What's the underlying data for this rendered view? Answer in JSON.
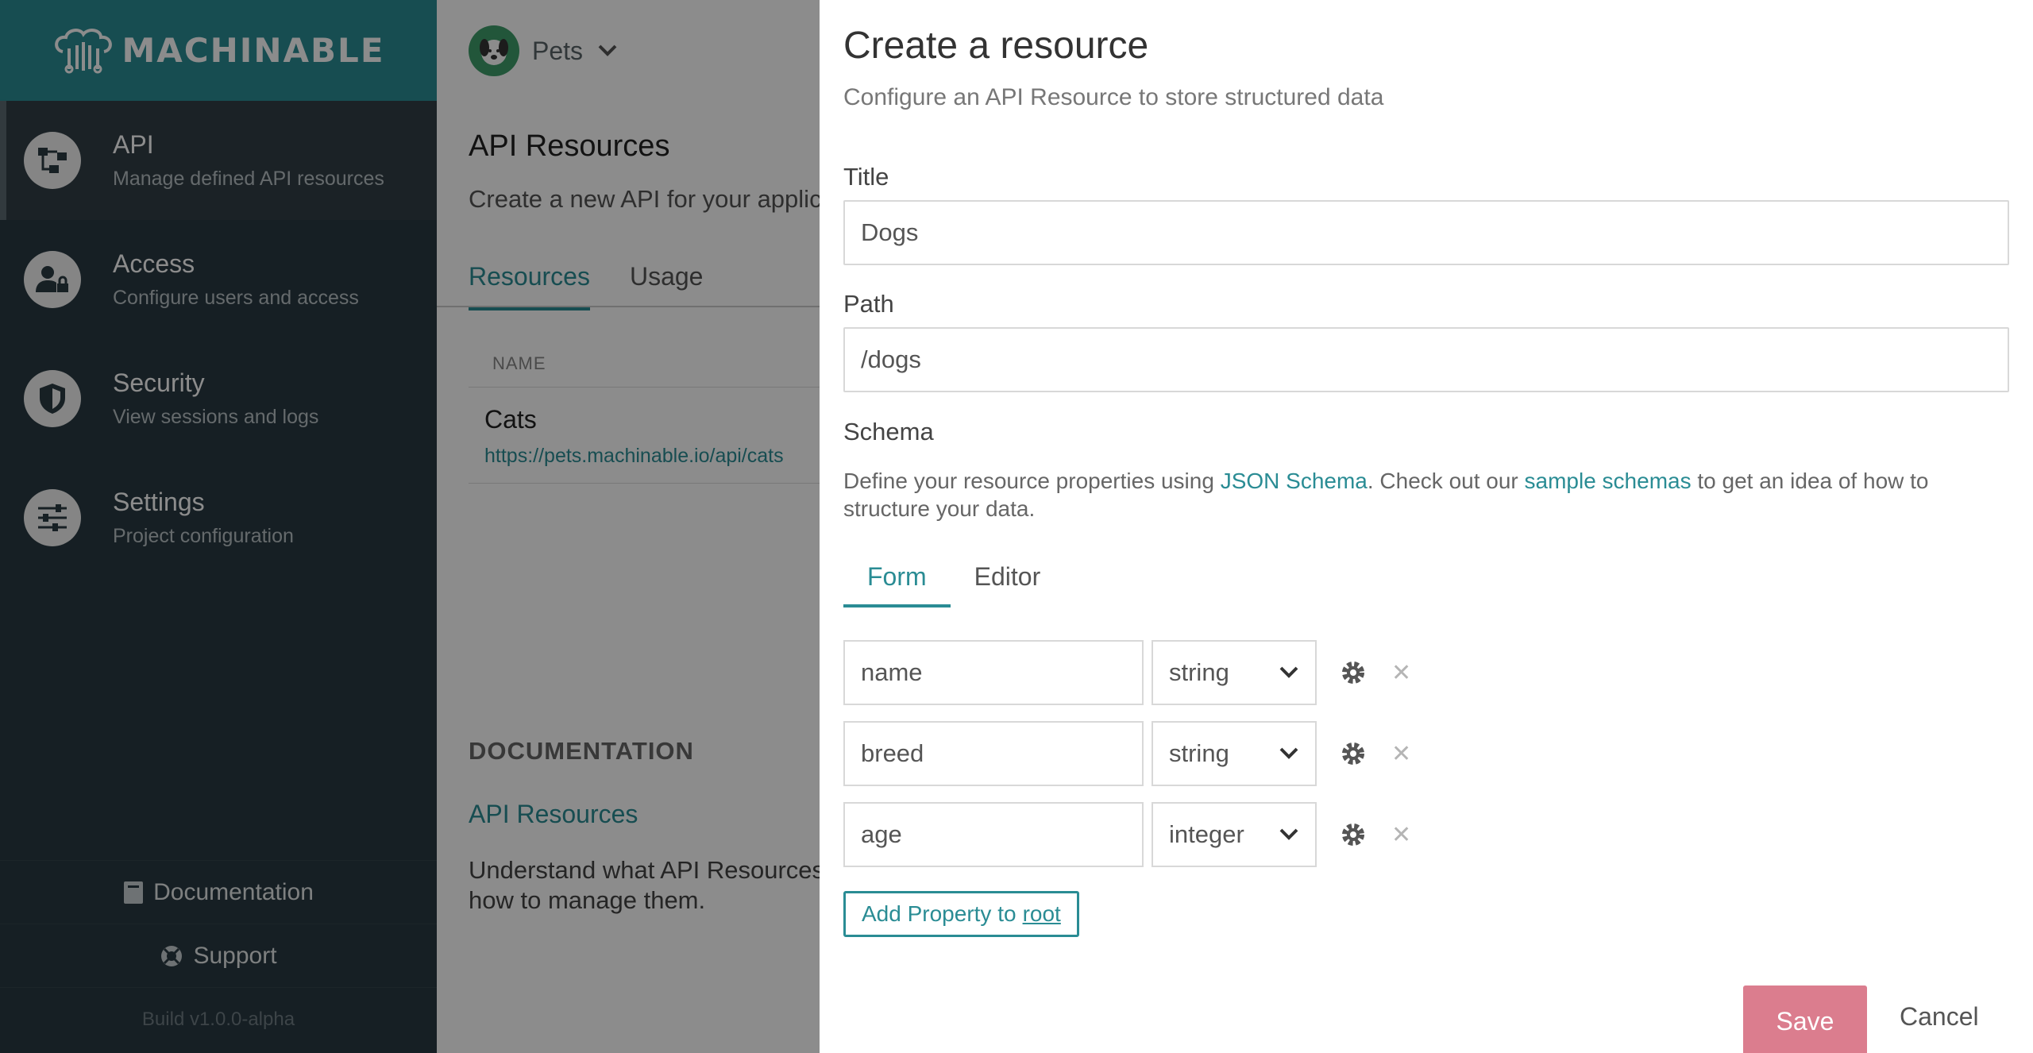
{
  "brand": {
    "name": "MACHINABLE"
  },
  "sidebar": {
    "items": [
      {
        "label": "API",
        "sub": "Manage defined API resources",
        "icon": "api-icon"
      },
      {
        "label": "Access",
        "sub": "Configure users and access",
        "icon": "user-lock-icon"
      },
      {
        "label": "Security",
        "sub": "View sessions and logs",
        "icon": "shield-icon"
      },
      {
        "label": "Settings",
        "sub": "Project configuration",
        "icon": "sliders-icon"
      }
    ],
    "documentation": "Documentation",
    "support": "Support",
    "build": "Build v1.0.0-alpha"
  },
  "main": {
    "project": "Pets",
    "title": "API Resources",
    "subtitle": "Create a new API for your applic",
    "tabs": [
      "Resources",
      "Usage"
    ],
    "table_header": "NAME",
    "rows": [
      {
        "name": "Cats",
        "url": "https://pets.machinable.io/api/cats"
      }
    ],
    "doc_heading": "DOCUMENTATION",
    "doc_link": "API Resources",
    "doc_text": "Understand what API Resources how to manage them."
  },
  "panel": {
    "title": "Create a resource",
    "lead": "Configure an API Resource to store structured data",
    "title_label": "Title",
    "title_value": "Dogs",
    "path_label": "Path",
    "path_value": "/dogs",
    "schema_label": "Schema",
    "schema_desc_1": "Define your resource properties using ",
    "schema_link_1": "JSON Schema",
    "schema_desc_2": ". Check out our ",
    "schema_link_2": "sample schemas",
    "schema_desc_3": " to get an idea of how to structure your data.",
    "tabs": [
      "Form",
      "Editor"
    ],
    "properties": [
      {
        "name": "name",
        "type": "string"
      },
      {
        "name": "breed",
        "type": "string"
      },
      {
        "name": "age",
        "type": "integer"
      }
    ],
    "add_prop": "Add Property to",
    "add_prop_target": "root",
    "save": "Save",
    "cancel": "Cancel"
  },
  "colors": {
    "brand": "#2a8c94",
    "sidebar": "#283942",
    "save": "#db7d8e"
  }
}
